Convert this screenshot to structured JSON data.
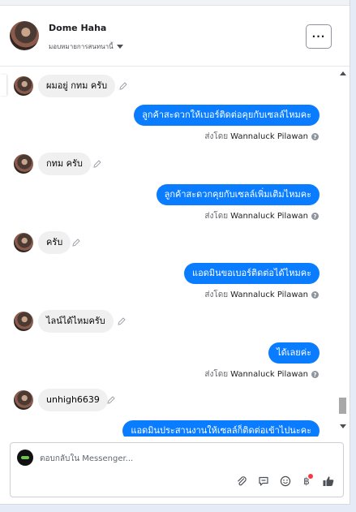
{
  "contact": {
    "name": "Dome Haha",
    "assign_label": "มอบหมายการสนทนานี้"
  },
  "header": {
    "more_label": "···"
  },
  "messages": [
    {
      "type": "in",
      "text": "ผมอยู่ กทม ครับ"
    },
    {
      "type": "out",
      "text": "ลูกค้าสะดวกให้เบอร์ติดต่อคุยกับเซลล์ไหมคะ",
      "sent_by_label": "ส่งโดย",
      "sender": "Wannaluck Pilawan"
    },
    {
      "type": "in",
      "text": "กทม ครับ"
    },
    {
      "type": "out",
      "text": "ลูกค้าสะดวกคุยกับเซลล์เพิ่มเติมไหมคะ",
      "sent_by_label": "ส่งโดย",
      "sender": "Wannaluck Pilawan"
    },
    {
      "type": "in",
      "text": "ครับ"
    },
    {
      "type": "out",
      "text": "แอดมินขอเบอร์ติดต่อได้ไหมคะ",
      "sent_by_label": "ส่งโดย",
      "sender": "Wannaluck Pilawan"
    },
    {
      "type": "in",
      "text": "ไลน์ได้ไหมครับ"
    },
    {
      "type": "out",
      "text": "ได้เลยค่ะ",
      "sent_by_label": "ส่งโดย",
      "sender": "Wannaluck Pilawan"
    },
    {
      "type": "in",
      "text": "unhigh6639"
    },
    {
      "type": "out",
      "text": "แอดมินประสานงานให้เซลล์ก็ติดต่อเข้าไปนะคะ"
    }
  ],
  "composer": {
    "placeholder": "ตอบกลับใน Messenger...",
    "icons": [
      "attach-icon",
      "saved-replies-icon",
      "emoji-icon",
      "payment-icon",
      "like-icon"
    ]
  },
  "colors": {
    "accent": "#0a7cff",
    "incoming": "#f0f0f0",
    "notify": "#fa383e"
  }
}
